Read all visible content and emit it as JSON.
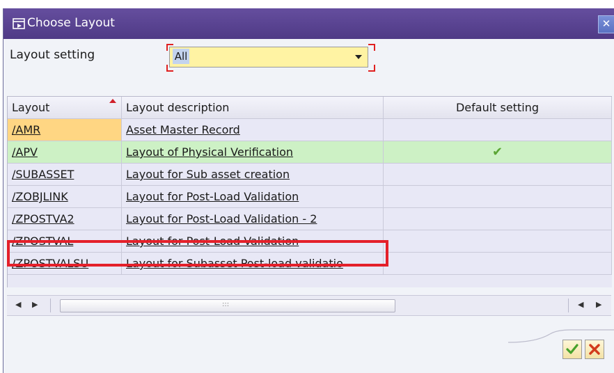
{
  "window": {
    "title": "Choose Layout"
  },
  "layout_setting": {
    "label": "Layout setting",
    "value": "All"
  },
  "table": {
    "headers": [
      "Layout",
      "Layout description",
      "Default setting"
    ],
    "rows": [
      {
        "layout": "/AMR",
        "description": "Asset Master Record",
        "default": ""
      },
      {
        "layout": "/APV",
        "description": "Layout of Physical Verification",
        "default": "✔"
      },
      {
        "layout": "/SUBASSET",
        "description": "Layout for Sub asset creation",
        "default": ""
      },
      {
        "layout": "/ZOBJLINK",
        "description": "Layout for Post-Load Validation",
        "default": ""
      },
      {
        "layout": "/ZPOSTVA2",
        "description": "Layout for Post-Load Validation - 2",
        "default": ""
      },
      {
        "layout": "/ZPOSTVAL",
        "description": "Layout for Post-Load Validation",
        "default": ""
      },
      {
        "layout": "/ZPOSTVALSU",
        "description": "Layout for Subasset Post-load validatio",
        "default": ""
      }
    ]
  },
  "scroll": {
    "grip": ":::"
  },
  "colors": {
    "title_bar": "#5a4492",
    "selected_row": "#cdf1c5",
    "highlight": "#e4202a"
  },
  "icons": [
    "layout-icon",
    "close-icon",
    "dropdown-arrow-icon",
    "sort-ascending-icon",
    "check-icon",
    "confirm-icon",
    "cancel-icon"
  ]
}
